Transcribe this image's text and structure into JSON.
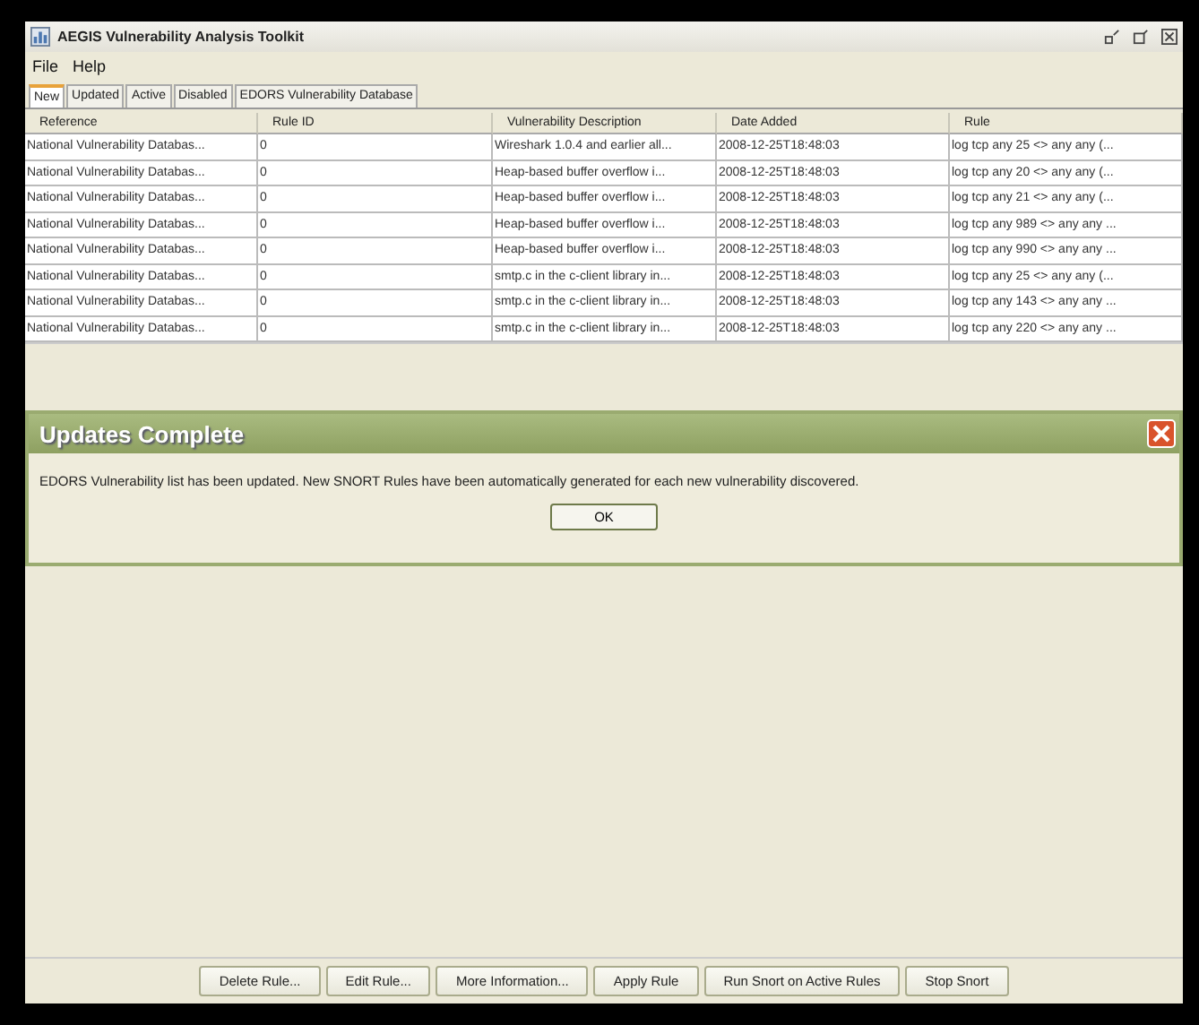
{
  "window": {
    "title": "AEGIS Vulnerability Analysis Toolkit"
  },
  "menu": [
    "File",
    "Help"
  ],
  "tabs": [
    {
      "label": "New",
      "selected": true
    },
    {
      "label": "Updated",
      "selected": false
    },
    {
      "label": "Active",
      "selected": false
    },
    {
      "label": "Disabled",
      "selected": false
    },
    {
      "label": "EDORS Vulnerability Database",
      "selected": false
    }
  ],
  "table": {
    "columns": [
      "Reference",
      "Rule ID",
      "Vulnerability Description",
      "Date Added",
      "Rule"
    ],
    "rows": [
      [
        "National Vulnerability Databas...",
        "0",
        "Wireshark 1.0.4 and earlier all...",
        "2008-12-25T18:48:03",
        "log tcp any 25 <> any any (..."
      ],
      [
        "National Vulnerability Databas...",
        "0",
        "Heap-based buffer overflow i...",
        "2008-12-25T18:48:03",
        "log tcp any 20 <> any any (..."
      ],
      [
        "National Vulnerability Databas...",
        "0",
        "Heap-based buffer overflow i...",
        "2008-12-25T18:48:03",
        "log tcp any 21 <> any any (..."
      ],
      [
        "National Vulnerability Databas...",
        "0",
        "Heap-based buffer overflow i...",
        "2008-12-25T18:48:03",
        "log tcp any 989 <> any any ..."
      ],
      [
        "National Vulnerability Databas...",
        "0",
        "Heap-based buffer overflow i...",
        "2008-12-25T18:48:03",
        "log tcp any 990 <> any any ..."
      ],
      [
        "National Vulnerability Databas...",
        "0",
        "smtp.c in the c-client library in...",
        "2008-12-25T18:48:03",
        "log tcp any 25 <> any any (..."
      ],
      [
        "National Vulnerability Databas...",
        "0",
        "smtp.c in the c-client library in...",
        "2008-12-25T18:48:03",
        "log tcp any 143 <> any any ..."
      ],
      [
        "National Vulnerability Databas...",
        "0",
        "smtp.c in the c-client library in...",
        "2008-12-25T18:48:03",
        "log tcp any 220 <> any any ..."
      ]
    ]
  },
  "dialog": {
    "title": "Updates Complete",
    "message": "EDORS Vulnerability list has been updated. New SNORT Rules have been automatically generated for each new vulnerability discovered.",
    "button": "OK"
  },
  "buttons": [
    "Delete Rule...",
    "Edit Rule...",
    "More Information...",
    "Apply Rule",
    "Run Snort on Active Rules",
    "Stop Snort"
  ]
}
